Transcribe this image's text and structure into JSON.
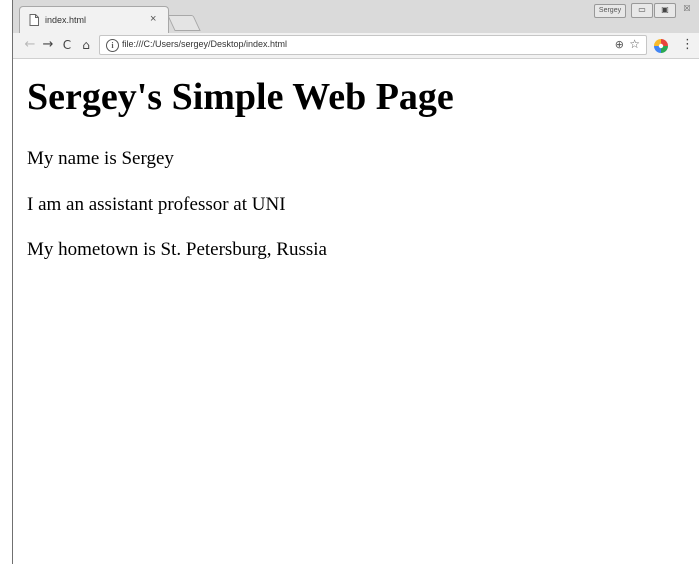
{
  "browser": {
    "tab": {
      "title": "index.html",
      "close_label": "×"
    },
    "profile_name": "Sergey",
    "window_controls": {
      "minimize": "▭",
      "maximize": "▣",
      "close": "☒"
    },
    "nav": {
      "back": "←",
      "forward": "→",
      "reload": "C",
      "home": "⌂"
    },
    "address_bar": {
      "info_symbol": "i",
      "url": "file:///C:/Users/sergey/Desktop/index.html"
    },
    "icons": {
      "zoom": "zoom-icon",
      "star": "bookmark-star-icon",
      "extension": "extension-icon",
      "menu": "menu-icon"
    },
    "icon_glyphs": {
      "zoom": "⊕",
      "star": "☆",
      "menu": "⋮"
    }
  },
  "page": {
    "heading": "Sergey's Simple Web Page",
    "paragraphs": [
      "My name is Sergey",
      "I am an assistant professor at UNI",
      "My hometown is St. Petersburg, Russia"
    ]
  },
  "colors": {
    "titlebar": "#dadada",
    "toolbar": "#f2f2f2",
    "page_background": "#ffffff"
  }
}
